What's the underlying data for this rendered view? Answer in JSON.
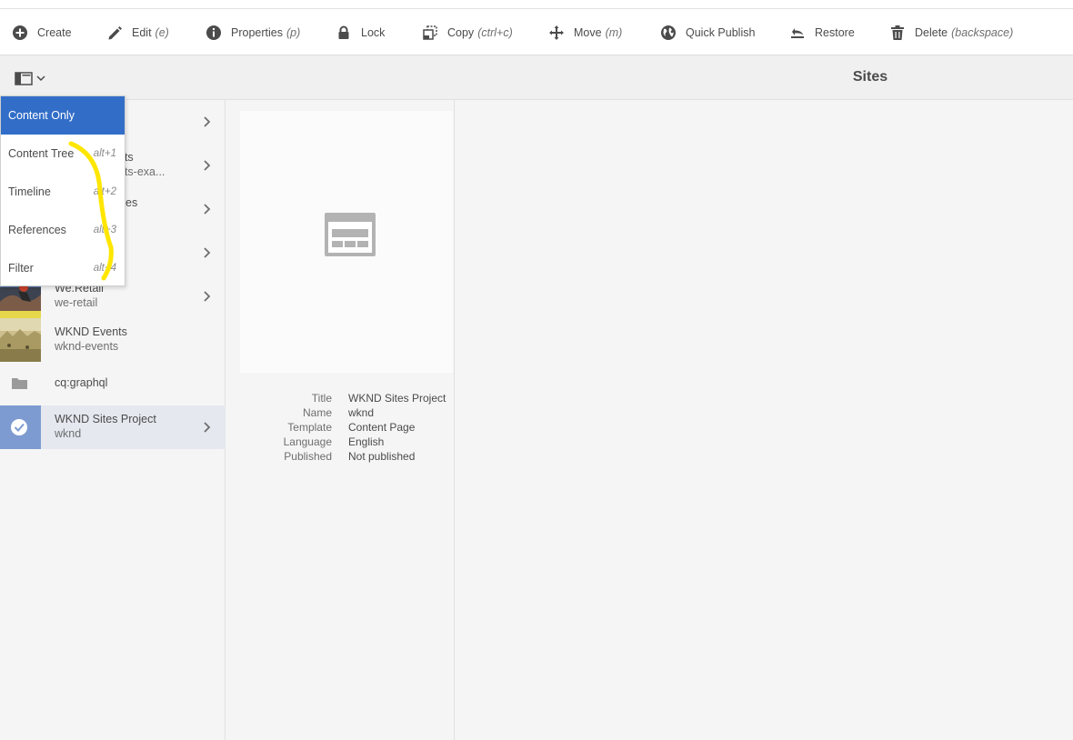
{
  "actions": [
    {
      "label": "Create",
      "shortcut": ""
    },
    {
      "label": "Edit",
      "shortcut": "(e)"
    },
    {
      "label": "Properties",
      "shortcut": "(p)"
    },
    {
      "label": "Lock",
      "shortcut": ""
    },
    {
      "label": "Copy",
      "shortcut": "(ctrl+c)"
    },
    {
      "label": "Move",
      "shortcut": "(m)"
    },
    {
      "label": "Quick Publish",
      "shortcut": ""
    },
    {
      "label": "Restore",
      "shortcut": ""
    },
    {
      "label": "Delete",
      "shortcut": "(backspace)"
    }
  ],
  "header": {
    "title": "Sites"
  },
  "rail_menu": {
    "items": [
      {
        "label": "Content Only",
        "shortcut": ""
      },
      {
        "label": "Content Tree",
        "shortcut": "alt+1"
      },
      {
        "label": "Timeline",
        "shortcut": "alt+2"
      },
      {
        "label": "References",
        "shortcut": "alt+3"
      },
      {
        "label": "Filter",
        "shortcut": "alt+4"
      }
    ]
  },
  "sites_list": {
    "rows": [
      {
        "title": "",
        "name": ""
      },
      {
        "title": "nts",
        "name": "nts-exa..."
      },
      {
        "title": "es",
        "name": ""
      },
      {
        "title": "",
        "name": ""
      },
      {
        "title": "We.Retail",
        "name": "we-retail"
      },
      {
        "title": "WKND Events",
        "name": "wknd-events"
      },
      {
        "title": "cq:graphql",
        "name": ""
      },
      {
        "title": "WKND Sites Project",
        "name": "wknd"
      }
    ]
  },
  "details": {
    "labels": {
      "title": "Title",
      "name": "Name",
      "template": "Template",
      "language": "Language",
      "published": "Published"
    },
    "values": {
      "title": "WKND Sites Project",
      "name": "wknd",
      "template": "Content Page",
      "language": "English",
      "published": "Not published"
    }
  },
  "colors": {
    "accent": "#326ec8",
    "selected_row": "#e5e8ef",
    "annotation": "#ffe600"
  }
}
